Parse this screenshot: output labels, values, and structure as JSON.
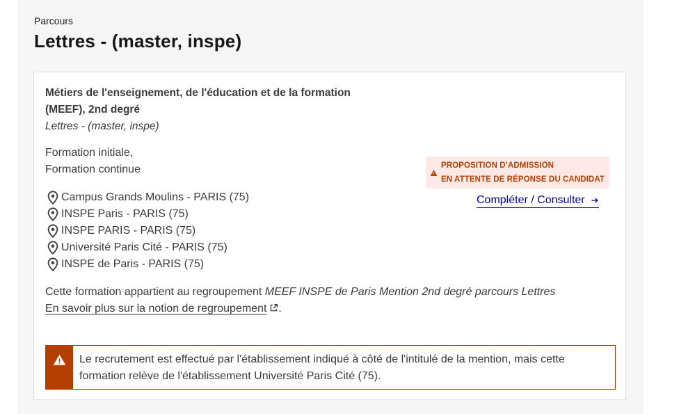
{
  "header": {
    "eyebrow": "Parcours",
    "title": "Lettres - (master, inspe)"
  },
  "formation": {
    "mention": "Métiers de l'enseignement, de l'éducation et de la formation (MEEF), 2nd degré",
    "parcours": "Lettres - (master, inspe)",
    "modes": [
      "Formation initiale,",
      "Formation continue"
    ],
    "locations": [
      "Campus Grands Moulins - PARIS (75)",
      "INSPE Paris - PARIS (75)",
      "INSPE PARIS - PARIS (75)",
      "Université Paris Cité - PARIS (75)",
      "INSPE de Paris - PARIS (75)"
    ],
    "location_icon": "map-pin-icon",
    "regroupement_prefix": "Cette formation appartient au regroupement ",
    "regroupement_name": "MEEF INSPE de Paris Mention 2nd degré parcours Lettres",
    "regroupement_link": "En savoir plus sur la notion de regroupement",
    "regroupement_link_suffix": "."
  },
  "status": {
    "line1": "PROPOSITION D’ADMISSION",
    "line2": "EN ATTENTE DE RÉPONSE DU CANDIDAT",
    "icon": "warning-icon",
    "color": "#b34000",
    "background": "#ffe9e6"
  },
  "action": {
    "label": "Compléter / Consulter",
    "icon": "arrow-right-icon",
    "color": "#000091"
  },
  "alert": {
    "text": "Le recrutement est effectué par l'établissement indiqué à côté de l'intitulé de la mention, mais cette formation relève de l'établissement Université Paris Cité (75).",
    "icon": "warning-icon",
    "color": "#b34000"
  }
}
